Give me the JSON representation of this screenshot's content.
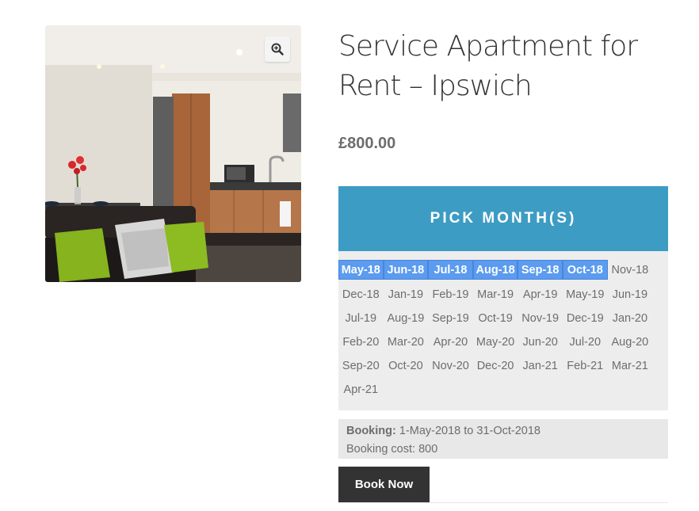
{
  "product": {
    "title": "Service Apartment for Rent – Ipswich",
    "price": "£800.00",
    "zoom_icon": "zoom-in-icon"
  },
  "picker": {
    "header": "PICK MONTH(S)",
    "rows": [
      [
        {
          "label": "May-18",
          "selected": true
        },
        {
          "label": "Jun-18",
          "selected": true
        },
        {
          "label": "Jul-18",
          "selected": true
        },
        {
          "label": "Aug-18",
          "selected": true
        },
        {
          "label": "Sep-18",
          "selected": true
        },
        {
          "label": "Oct-18",
          "selected": true
        },
        {
          "label": "Nov-18",
          "selected": false
        }
      ],
      [
        {
          "label": "Dec-18",
          "selected": false
        },
        {
          "label": "Jan-19",
          "selected": false
        },
        {
          "label": "Feb-19",
          "selected": false
        },
        {
          "label": "Mar-19",
          "selected": false
        },
        {
          "label": "Apr-19",
          "selected": false
        },
        {
          "label": "May-19",
          "selected": false
        },
        {
          "label": "Jun-19",
          "selected": false
        }
      ],
      [
        {
          "label": "Jul-19",
          "selected": false
        },
        {
          "label": "Aug-19",
          "selected": false
        },
        {
          "label": "Sep-19",
          "selected": false
        },
        {
          "label": "Oct-19",
          "selected": false
        },
        {
          "label": "Nov-19",
          "selected": false
        },
        {
          "label": "Dec-19",
          "selected": false
        },
        {
          "label": "Jan-20",
          "selected": false
        }
      ],
      [
        {
          "label": "Feb-20",
          "selected": false
        },
        {
          "label": "Mar-20",
          "selected": false
        },
        {
          "label": "Apr-20",
          "selected": false
        },
        {
          "label": "May-20",
          "selected": false
        },
        {
          "label": "Jun-20",
          "selected": false
        },
        {
          "label": "Jul-20",
          "selected": false
        },
        {
          "label": "Aug-20",
          "selected": false
        }
      ],
      [
        {
          "label": "Sep-20",
          "selected": false
        },
        {
          "label": "Oct-20",
          "selected": false
        },
        {
          "label": "Nov-20",
          "selected": false
        },
        {
          "label": "Dec-20",
          "selected": false
        },
        {
          "label": "Jan-21",
          "selected": false
        },
        {
          "label": "Feb-21",
          "selected": false
        },
        {
          "label": "Mar-21",
          "selected": false
        }
      ],
      [
        {
          "label": "Apr-21",
          "selected": false
        }
      ]
    ]
  },
  "booking": {
    "label": "Booking:",
    "range": "1-May-2018 to 31-Oct-2018",
    "cost": "Booking cost: 800"
  },
  "actions": {
    "book_now": "Book Now"
  },
  "colors": {
    "picker_header": "#3d9cc3",
    "selected_month": "#5b9bf0",
    "button": "#333333"
  }
}
